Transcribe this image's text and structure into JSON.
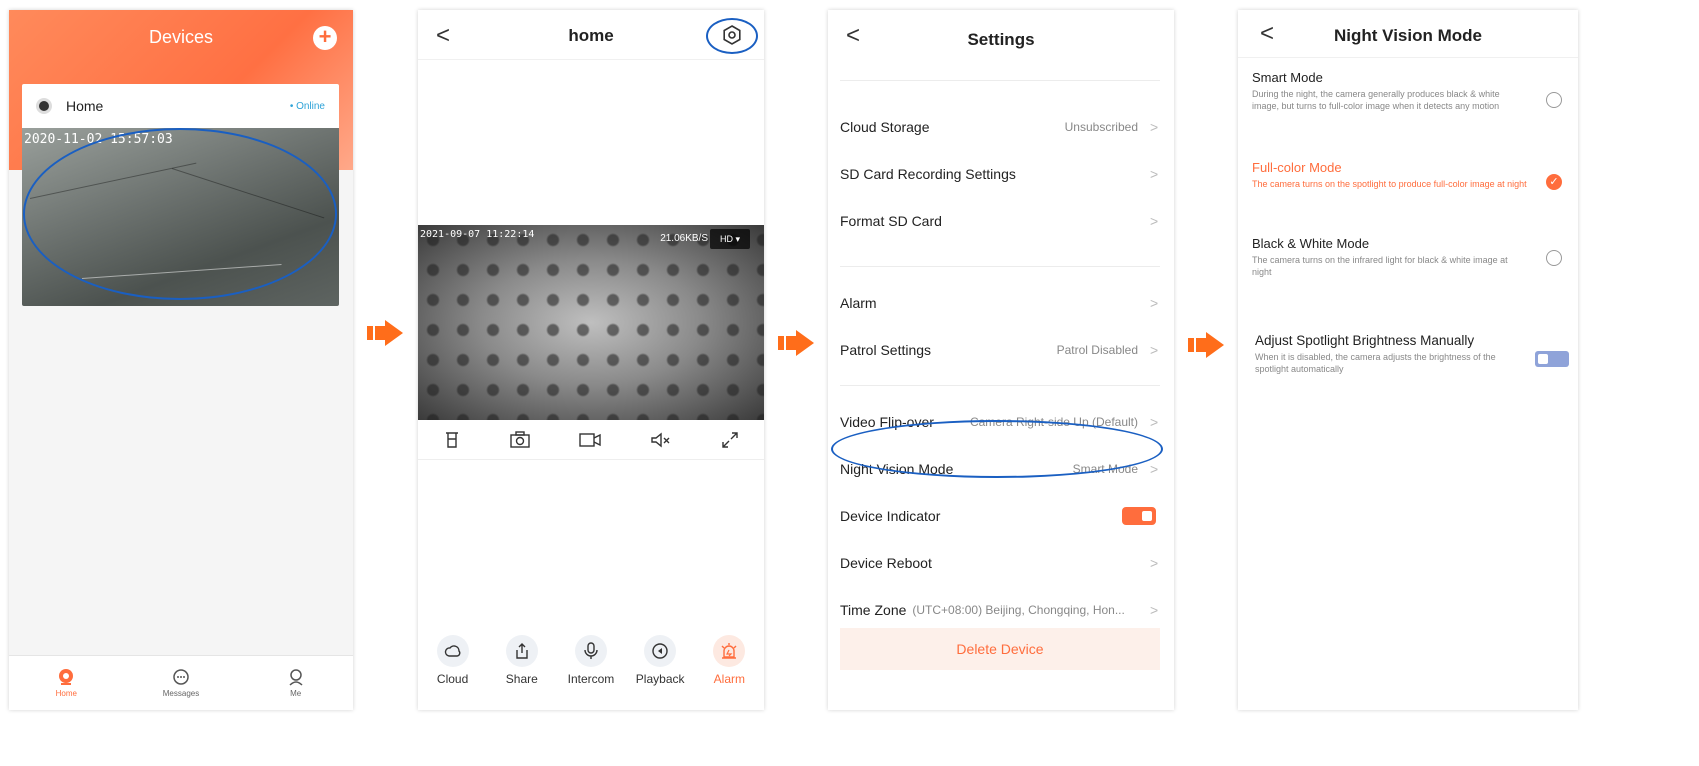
{
  "screen1": {
    "title": "Devices",
    "device_name": "Home",
    "status": "• Online",
    "snapshot_time": "2020-11-02 15:57:03",
    "tabs": [
      {
        "label": "Home",
        "icon": "home-icon"
      },
      {
        "label": "Messages",
        "icon": "messages-icon"
      },
      {
        "label": "Me",
        "icon": "me-icon"
      }
    ]
  },
  "screen2": {
    "title": "home",
    "video_time": "2021-09-07 11:22:14",
    "bitrate": "21.06KB/S",
    "quality": "HD ▾",
    "controls": [
      "ptz-icon",
      "snapshot-icon",
      "record-icon",
      "mute-icon",
      "fullscreen-icon"
    ],
    "actions": [
      {
        "label": "Cloud",
        "icon": "cloud-icon"
      },
      {
        "label": "Share",
        "icon": "share-icon"
      },
      {
        "label": "Intercom",
        "icon": "microphone-icon"
      },
      {
        "label": "Playback",
        "icon": "playback-icon"
      },
      {
        "label": "Alarm",
        "icon": "alarm-icon"
      }
    ]
  },
  "screen3": {
    "title": "Settings",
    "rows": {
      "cloud_storage": {
        "label": "Cloud Storage",
        "value": "Unsubscribed"
      },
      "sd_recording": {
        "label": "SD Card Recording Settings",
        "value": ""
      },
      "format_sd": {
        "label": "Format SD Card",
        "value": ""
      },
      "alarm": {
        "label": "Alarm",
        "value": ""
      },
      "patrol": {
        "label": "Patrol Settings",
        "value": "Patrol Disabled"
      },
      "flip": {
        "label": "Video Flip-over",
        "value": "Camera Right-side Up (Default)"
      },
      "night_vision": {
        "label": "Night Vision Mode",
        "value": "Smart Mode"
      },
      "indicator": {
        "label": "Device Indicator",
        "value": ""
      },
      "reboot": {
        "label": "Device Reboot",
        "value": ""
      },
      "timezone": {
        "label": "Time Zone",
        "value": "(UTC+08:00) Beijing, Chongqing, Hon..."
      }
    },
    "delete_label": "Delete Device"
  },
  "screen4": {
    "title": "Night Vision Mode",
    "options": [
      {
        "title": "Smart Mode",
        "desc": "During the night, the camera generally produces black & white image, but turns to full-color image when it detects any motion",
        "selected": false
      },
      {
        "title": "Full-color Mode",
        "desc": "The camera turns on the spotlight to produce full-color image at night",
        "selected": true
      },
      {
        "title": "Black & White Mode",
        "desc": "The camera turns on the infrared light for black & white image at night",
        "selected": false
      }
    ],
    "spotlight": {
      "title": "Adjust Spotlight Brightness Manually",
      "desc": "When it is disabled, the camera adjusts the brightness of the spotlight automatically"
    }
  },
  "colors": {
    "accent": "#ff6d3d",
    "highlight": "#1a5fc2"
  }
}
